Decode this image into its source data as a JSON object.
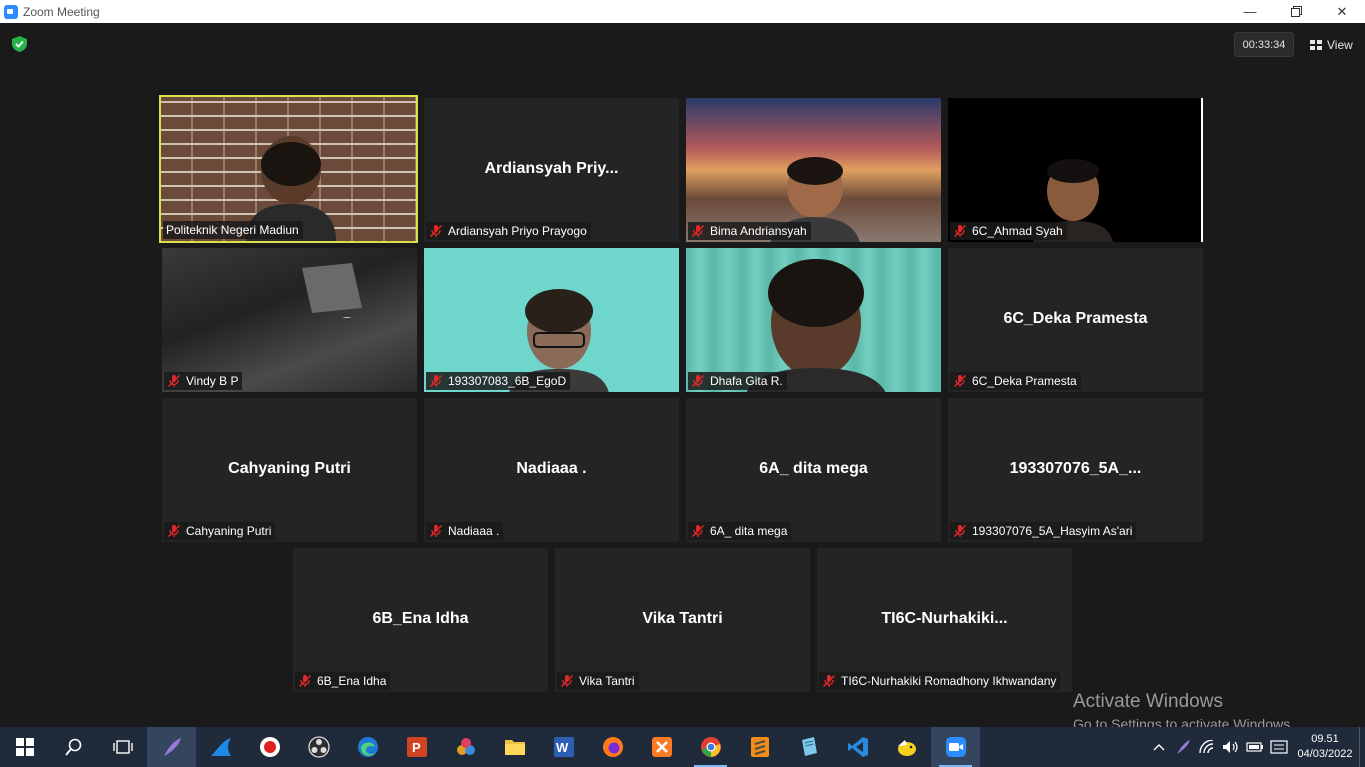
{
  "window": {
    "title": "Zoom Meeting"
  },
  "header": {
    "timer": "00:33:34",
    "view_label": "View"
  },
  "tiles": [
    {
      "center_name": "",
      "name": "Politeknik Negeri Madiun"
    },
    {
      "center_name": "Ardiansyah  Priy...",
      "name": "Ardiansyah Priyo Prayogo"
    },
    {
      "center_name": "",
      "name": "Bima Andriansyah"
    },
    {
      "center_name": "",
      "name": "6C_Ahmad Syah"
    },
    {
      "center_name": "",
      "name": "Vindy B P"
    },
    {
      "center_name": "",
      "name": "193307083_6B_EgoD"
    },
    {
      "center_name": "",
      "name": "Dhafa Gita R."
    },
    {
      "center_name": "6C_Deka Pramesta",
      "name": "6C_Deka Pramesta"
    },
    {
      "center_name": "Cahyaning Putri",
      "name": "Cahyaning Putri"
    },
    {
      "center_name": "Nadiaaa .",
      "name": "Nadiaaa ."
    },
    {
      "center_name": "6A_ dita mega",
      "name": "6A_ dita mega"
    },
    {
      "center_name": "193307076_5A_...",
      "name": "193307076_5A_Hasyim As'ari"
    },
    {
      "center_name": "6B_Ena Idha",
      "name": "6B_Ena Idha"
    },
    {
      "center_name": "Vika Tantri",
      "name": "Vika Tantri"
    },
    {
      "center_name": "TI6C-Nurhakiki...",
      "name": "TI6C-Nurhakiki Romadhony Ikhwandany"
    }
  ],
  "watermark": {
    "line1": "Activate Windows",
    "line2": "Go to Settings to activate Windows."
  },
  "taskbar": {
    "apps": [
      "start-icon",
      "search-icon",
      "task-view-icon",
      "feather-icon",
      "shark-fin-icon",
      "record-icon",
      "obs-icon",
      "edge-icon",
      "powerpoint-icon",
      "davinci-icon",
      "file-explorer-icon",
      "word-icon",
      "firefox-icon",
      "xampp-icon",
      "chrome-icon",
      "sublime-icon",
      "notepad-icon",
      "vscode-icon",
      "bird-icon",
      "zoom-icon"
    ],
    "time": "09.51",
    "date": "04/03/2022"
  },
  "colors": {
    "active_speaker": "#d9e24a",
    "tile_bg": "#242424",
    "meeting_bg": "#1a1a1a",
    "mute_red": "#e02828"
  }
}
